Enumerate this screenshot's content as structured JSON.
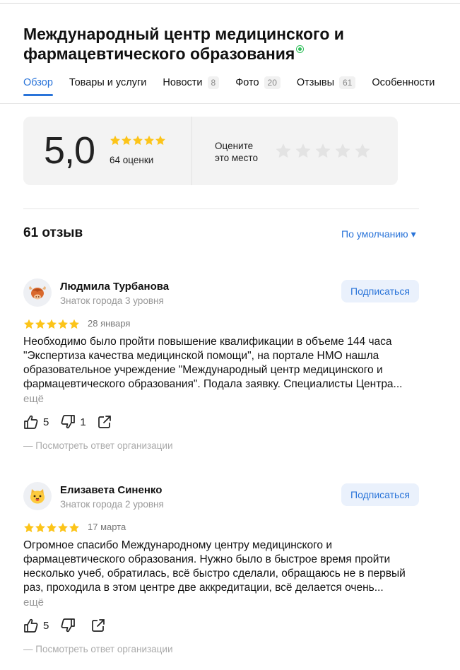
{
  "org": {
    "title": "Международный центр медицинского и фармацевтического образования"
  },
  "tabs": [
    {
      "label": "Обзор",
      "count": ""
    },
    {
      "label": "Товары и услуги",
      "count": ""
    },
    {
      "label": "Новости",
      "count": "8"
    },
    {
      "label": "Фото",
      "count": "20"
    },
    {
      "label": "Отзывы",
      "count": "61"
    },
    {
      "label": "Особенности",
      "count": ""
    }
  ],
  "rating": {
    "value": "5,0",
    "stars": 5,
    "count_label": "64 оценки",
    "rate_prompt_line1": "Оцените",
    "rate_prompt_line2": "это место"
  },
  "reviews_section": {
    "count_label": "61 отзыв",
    "sort_label": "По умолчанию ▾"
  },
  "reviews": [
    {
      "author": "Людмила Турбанова",
      "level": "Знаток города 3 уровня",
      "avatar_icon": "highland-cow-icon",
      "stars": 5,
      "date": "28 января",
      "text_lines": [
        "Необходимо было пройти повышение квалификации в объеме 144 часа",
        "\"Экспертиза качества медицинской помощи\", на портале НМО нашла",
        "образовательное учреждение \"Международный центр медицинского и",
        "фармацевтического образования\". Подала заявку. Специалисты Центра..."
      ],
      "more": "ещё",
      "likes": "5",
      "dislikes": "1",
      "subscribe": "Подписаться",
      "org_answer": "— Посмотреть ответ организации"
    },
    {
      "author": "Елизавета Синенко",
      "level": "Знаток города 2 уровня",
      "avatar_icon": "cat-face-icon",
      "stars": 5,
      "date": "17 марта",
      "text_lines": [
        "Огромное спасибо Международному центру медицинского и",
        "фармацевтического образования. Нужно было в быстрое время пройти",
        "несколько учеб, обратилась, всё быстро сделали, обращаюсь не в первый",
        "раз, проходила в этом центре две аккредитации, всё делается очень..."
      ],
      "more": "ещё",
      "likes": "5",
      "dislikes": "",
      "subscribe": "Подписаться",
      "org_answer": "— Посмотреть ответ организации"
    }
  ],
  "colors": {
    "accent": "#2a74d9",
    "star_gold": "#fcc419",
    "star_empty": "#e3e3e3",
    "verified": "#2ebd59"
  }
}
